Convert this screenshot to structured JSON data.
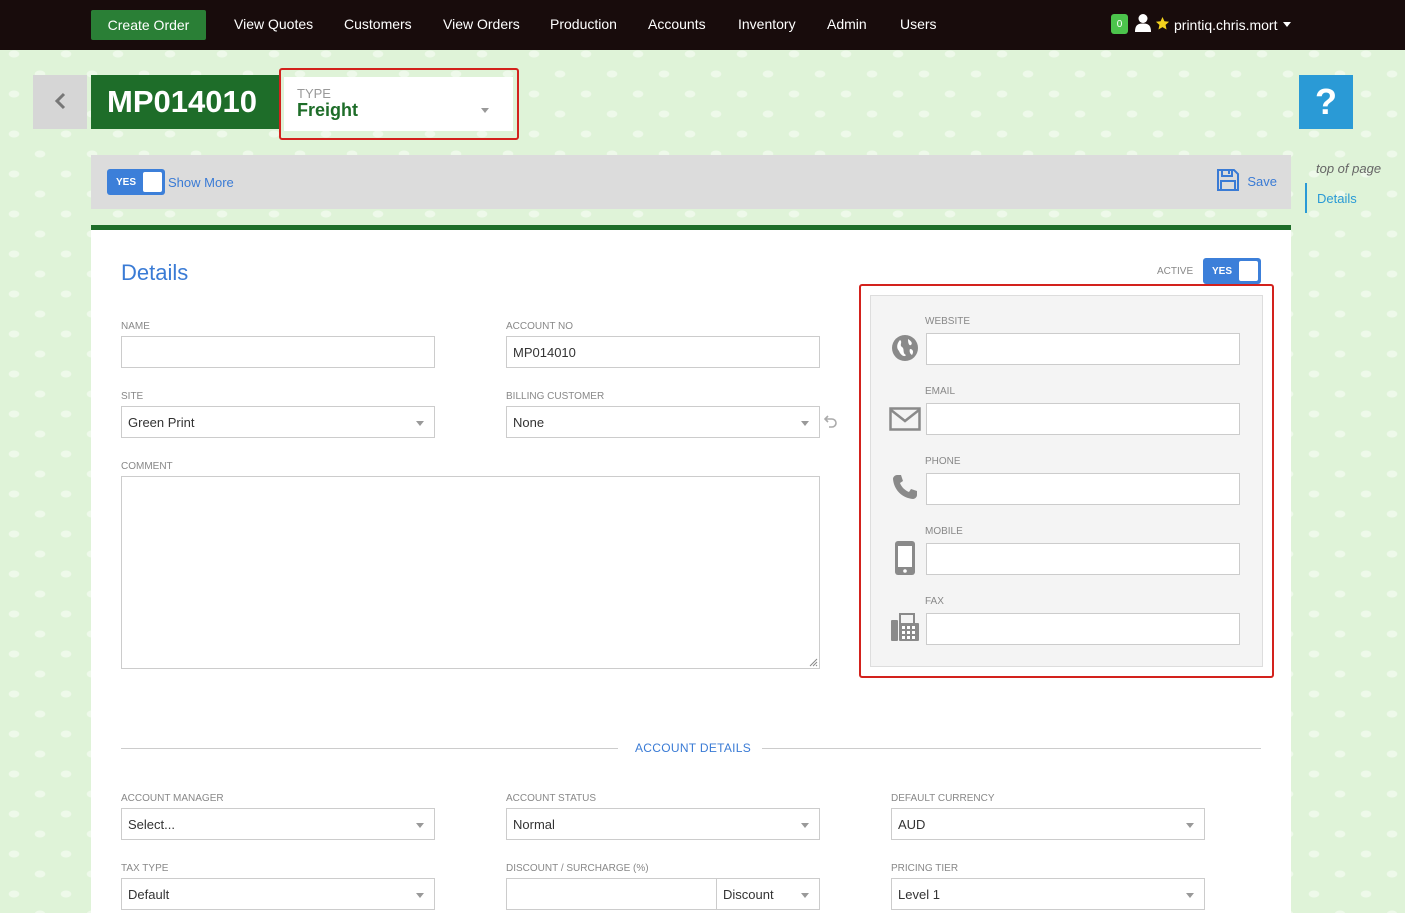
{
  "nav": {
    "create_order": "Create Order",
    "items": [
      "View Quotes",
      "Customers",
      "View Orders",
      "Production",
      "Accounts",
      "Inventory",
      "Admin",
      "Users"
    ],
    "notification_count": "0",
    "username": "printiq.chris.mort"
  },
  "header": {
    "record_id": "MP014010",
    "type_label": "TYPE",
    "type_value": "Freight",
    "help": "?"
  },
  "toolbar": {
    "show_more_toggle": "YES",
    "show_more": "Show More",
    "save": "Save"
  },
  "side_nav": {
    "top": "top of page",
    "details": "Details"
  },
  "details": {
    "title": "Details",
    "active_label": "ACTIVE",
    "active_toggle": "YES",
    "name_label": "NAME",
    "name_value": "",
    "account_no_label": "ACCOUNT NO",
    "account_no_value": "MP014010",
    "site_label": "SITE",
    "site_value": "Green Print",
    "billing_label": "BILLING CUSTOMER",
    "billing_value": "None",
    "comment_label": "COMMENT",
    "contact": {
      "website_label": "WEBSITE",
      "email_label": "EMAIL",
      "phone_label": "PHONE",
      "mobile_label": "MOBILE",
      "fax_label": "FAX"
    }
  },
  "account_details": {
    "heading": "ACCOUNT DETAILS",
    "account_manager_label": "ACCOUNT MANAGER",
    "account_manager_value": "Select...",
    "account_status_label": "ACCOUNT STATUS",
    "account_status_value": "Normal",
    "currency_label": "DEFAULT CURRENCY",
    "currency_value": "AUD",
    "tax_type_label": "TAX TYPE",
    "tax_type_value": "Default",
    "discount_label": "DISCOUNT / SURCHARGE (%)",
    "discount_value": "",
    "discount_mode": "Discount",
    "pricing_tier_label": "PRICING TIER",
    "pricing_tier_value": "Level 1"
  },
  "colors": {
    "nav_bg": "#180c0c",
    "brand_green": "#1e6d29",
    "accent_blue": "#3a7bd5",
    "highlight_red": "#d3221d"
  }
}
